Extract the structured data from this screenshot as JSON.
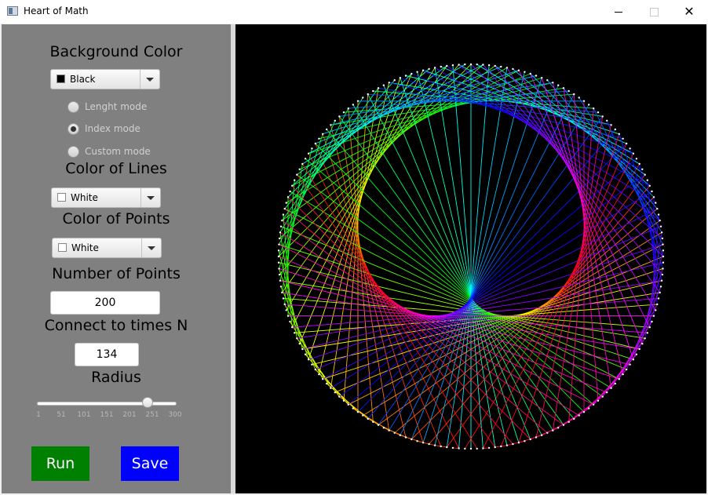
{
  "window": {
    "title": "Heart of Math",
    "close_glyph": "✕"
  },
  "panel": {
    "background_color": {
      "heading": "Background Color",
      "selected": "Black",
      "swatch": "#000000"
    },
    "modes": [
      {
        "label": "Lenght mode",
        "selected": false
      },
      {
        "label": "Index mode",
        "selected": true
      },
      {
        "label": "Custom mode",
        "selected": false
      }
    ],
    "line_color": {
      "heading": "Color of Lines",
      "selected": "White",
      "swatch": "#ffffff"
    },
    "point_color": {
      "heading": "Color of Points",
      "selected": "White",
      "swatch": "#ffffff"
    },
    "num_points": {
      "heading": "Number of Points",
      "value": "200"
    },
    "multiplier": {
      "heading": "Connect to times N",
      "value": "134"
    },
    "radius": {
      "heading": "Radius",
      "value": 240,
      "min": 1,
      "max": 300,
      "tick_labels": [
        "1",
        "51",
        "101",
        "151",
        "201",
        "251",
        "300"
      ]
    },
    "run_label": "Run",
    "save_label": "Save"
  },
  "canvas": {
    "background": "#000000",
    "points": 200,
    "multiplier": 134
  }
}
